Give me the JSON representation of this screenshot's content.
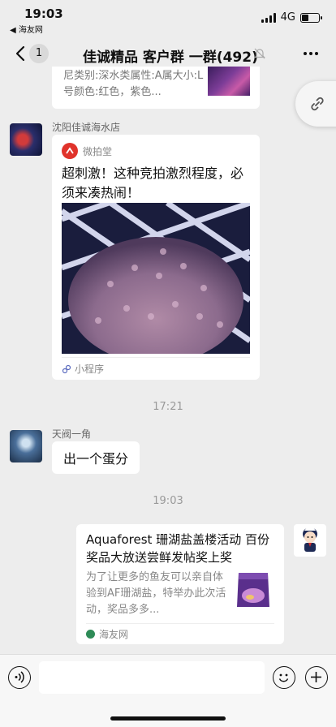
{
  "status_bar": {
    "time": "19:03",
    "back_app": "◀ 海友网",
    "network": "4G",
    "battery_level": 0.4
  },
  "nav": {
    "back_count": "1",
    "title": "佳诚精品 客户群 一群(492)"
  },
  "messages": {
    "top_card": {
      "description": "尼类别:深水类属性:A属大小:L号颜色:红色，紫色..."
    },
    "mini_program": {
      "sender": "沈阳佳诚海水店",
      "brand": "微拍堂",
      "title": "超刺激！这种竞拍激烈程度，必须来凑热闹！",
      "footer": "小程序"
    },
    "time_1": "17:21",
    "text_message": {
      "sender": "天阀一角",
      "text": "出一个蛋分"
    },
    "time_2": "19:03",
    "article": {
      "title": "Aquaforest 珊湖盐盖楼活动 百份奖品大放送尝鲜发帖奖上奖",
      "description": "为了让更多的鱼友可以亲自体验到AF珊湖盐，特举办此次活动，奖品多多...",
      "source": "海友网"
    }
  },
  "colors": {
    "background": "#ededed",
    "bubble": "#ffffff",
    "brand_red": "#e0332b"
  },
  "icons": [
    "chevron-left-icon",
    "mute-icon",
    "more-icon",
    "link-icon",
    "mini-program-icon",
    "voice-icon",
    "emoji-icon",
    "plus-icon"
  ]
}
